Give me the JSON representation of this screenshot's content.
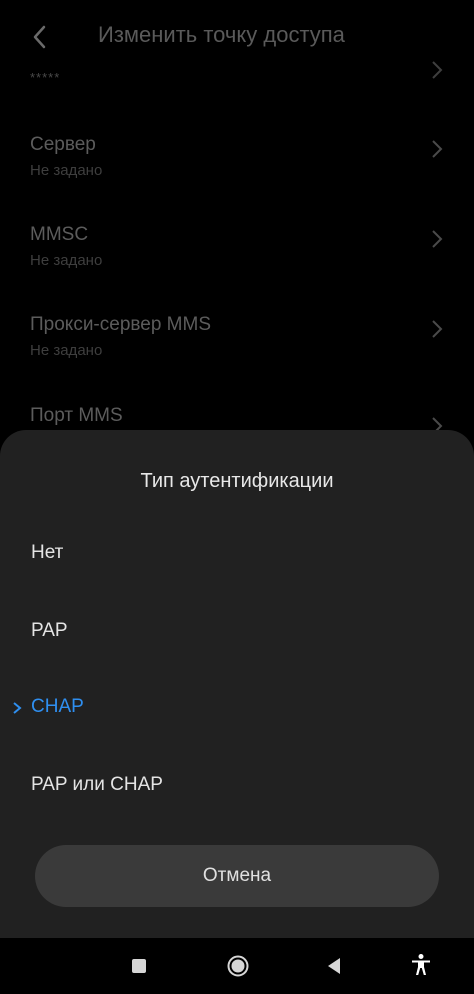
{
  "header": {
    "title": "Изменить точку доступа",
    "back_icon": "back-arrow-icon"
  },
  "masked_value": "*****",
  "settings": [
    {
      "label": "Сервер",
      "value": "Не задано"
    },
    {
      "label": "MMSC",
      "value": "Не задано"
    },
    {
      "label": "Прокси-сервер MMS",
      "value": "Не задано"
    },
    {
      "label": "Порт MMS",
      "value": ""
    }
  ],
  "dialog": {
    "title": "Тип аутентификации",
    "options": [
      {
        "label": "Нет",
        "selected": false
      },
      {
        "label": "PAP",
        "selected": false
      },
      {
        "label": "CHAP",
        "selected": true
      },
      {
        "label": "PAP или CHAP",
        "selected": false
      }
    ],
    "cancel_label": "Отмена",
    "selected_color": "#2f8ff0"
  },
  "navbar": {
    "icons": [
      "recent-apps-icon",
      "home-icon",
      "back-triangle-icon",
      "accessibility-icon"
    ]
  }
}
